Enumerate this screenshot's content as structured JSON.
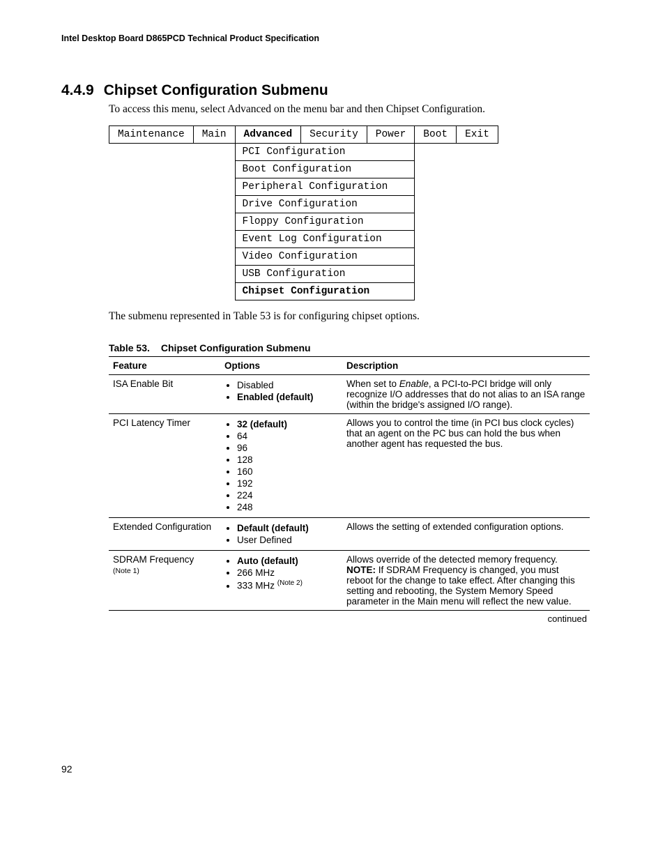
{
  "header": "Intel Desktop Board D865PCD Technical Product Specification",
  "section": {
    "number": "4.4.9",
    "title": "Chipset Configuration Submenu",
    "intro": "To access this menu, select Advanced on the menu bar and then Chipset Configuration."
  },
  "menubar": {
    "items": [
      "Maintenance",
      "Main",
      "Advanced",
      "Security",
      "Power",
      "Boot",
      "Exit"
    ],
    "active": "Advanced",
    "submenu": [
      "PCI Configuration",
      "Boot Configuration",
      "Peripheral Configuration",
      "Drive Configuration",
      "Floppy Configuration",
      "Event Log Configuration",
      "Video Configuration",
      "USB Configuration",
      "Chipset Configuration"
    ]
  },
  "para2": "The submenu represented in Table 53 is for configuring chipset options.",
  "table": {
    "label": "Table 53.",
    "title": "Chipset Configuration Submenu",
    "headers": {
      "c1": "Feature",
      "c2": "Options",
      "c3": "Description"
    },
    "rows": {
      "r1": {
        "feature": "ISA Enable Bit",
        "opts": {
          "o1": "Disabled",
          "o2": "Enabled (default)"
        },
        "desc_pre": "When set to ",
        "desc_em": "Enable",
        "desc_post": ", a PCI-to-PCI bridge will only recognize I/O addresses that do not alias to an ISA range (within the bridge's assigned I/O range)."
      },
      "r2": {
        "feature": "PCI Latency Timer",
        "opts": {
          "o1": "32 (default)",
          "o2": "64",
          "o3": "96",
          "o4": "128",
          "o5": "160",
          "o6": "192",
          "o7": "224",
          "o8": "248"
        },
        "desc": "Allows you to control the time (in PCI bus clock cycles) that an agent on the PC bus can hold the bus when another agent has requested the bus."
      },
      "r3": {
        "feature": "Extended Configuration",
        "opts": {
          "o1": "Default (default)",
          "o2": "User Defined"
        },
        "desc": "Allows the setting of extended configuration options."
      },
      "r4": {
        "feature": "SDRAM Frequency",
        "feature_note": "(Note 1)",
        "opts": {
          "o1": "Auto (default)",
          "o2": "266 MHz",
          "o3": "333 MHz ",
          "o3_note": "(Note 2)"
        },
        "desc_line1": "Allows override of the detected memory frequency.",
        "desc_note_label": "NOTE:",
        "desc_note": "  If SDRAM Frequency is changed, you must reboot for the change to take effect.  After changing this setting and rebooting, the System Memory Speed parameter in the Main menu will reflect the new value."
      }
    },
    "continued": "continued"
  },
  "page_number": "92"
}
